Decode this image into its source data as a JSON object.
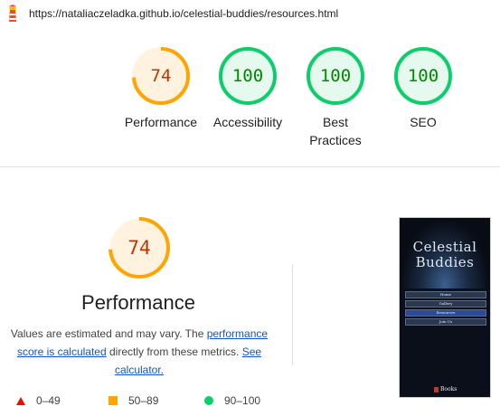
{
  "url": "https://nataliaczeladka.github.io/celestial-buddies/resources.html",
  "colors": {
    "pass": "#0cce6b",
    "pass_text": "#008800",
    "pass_bg": "#e6f9ee",
    "average": "#ffa400",
    "average_text": "#c33300",
    "average_bg": "#fff3e0",
    "fail": "#eb0f00"
  },
  "scores": [
    {
      "label": "Performance",
      "value": "74",
      "score": 0.74,
      "rating": "average"
    },
    {
      "label": "Accessibility",
      "value": "100",
      "score": 1.0,
      "rating": "pass"
    },
    {
      "label": "Best Practices",
      "value": "100",
      "score": 1.0,
      "rating": "pass"
    },
    {
      "label": "SEO",
      "value": "100",
      "score": 1.0,
      "rating": "pass"
    }
  ],
  "performance": {
    "value": "74",
    "score": 0.74,
    "title": "Performance",
    "desc_part1": "Values are estimated and may vary. The ",
    "desc_link1": "performance score is calculated",
    "desc_part2": " directly from these metrics. ",
    "desc_link2": "See calculator."
  },
  "legend": [
    {
      "icon": "triangle-icon",
      "label": "0–49"
    },
    {
      "icon": "square-icon",
      "label": "50–89"
    },
    {
      "icon": "circle-icon",
      "label": "90–100"
    }
  ],
  "thumbnail": {
    "title_line1": "Celestial",
    "title_line2": "Buddies",
    "nav": [
      "Home",
      "Gallery",
      "Resources",
      "Join Us"
    ],
    "books_label": "Books"
  }
}
